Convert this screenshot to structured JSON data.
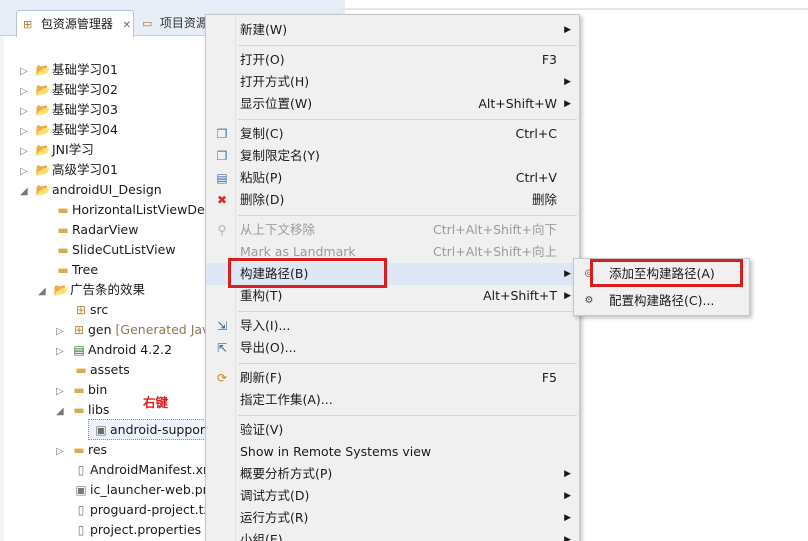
{
  "explorer": {
    "tabs": [
      {
        "label": "包资源管理器",
        "close": "✕"
      },
      {
        "label": "项目资源",
        "close": ""
      }
    ],
    "tree": [
      {
        "label": "基础学习01",
        "decor": ""
      },
      {
        "label": "基础学习02",
        "decor": ""
      },
      {
        "label": "基础学习03",
        "decor": ""
      },
      {
        "label": "基础学习04",
        "decor": ""
      },
      {
        "label": "JNI学习",
        "decor": ""
      },
      {
        "label": "高级学习01",
        "decor": ""
      },
      {
        "label": "androidUI_Design",
        "decor": ""
      },
      {
        "label": "HorizontalListViewDem",
        "decor": ""
      },
      {
        "label": "RadarView",
        "decor": ""
      },
      {
        "label": "SlideCutListView",
        "decor": ""
      },
      {
        "label": "Tree",
        "decor": ""
      },
      {
        "label": "广告条的效果",
        "decor": ""
      },
      {
        "label": "src",
        "decor": ""
      },
      {
        "label": "gen",
        "decor": "[Generated Jav"
      },
      {
        "label": "Android 4.2.2",
        "decor": ""
      },
      {
        "label": "assets",
        "decor": ""
      },
      {
        "label": "bin",
        "decor": ""
      },
      {
        "label": "libs",
        "decor": ""
      },
      {
        "label": "android-suppor",
        "decor": ""
      },
      {
        "label": "res",
        "decor": ""
      },
      {
        "label": "AndroidManifest.xn",
        "decor": ""
      },
      {
        "label": "ic_launcher-web.png",
        "decor": ""
      },
      {
        "label": "proguard-project.tx",
        "decor": ""
      },
      {
        "label": "project.properties",
        "decor": ""
      }
    ],
    "annotation": "右键"
  },
  "context_menu": {
    "items": [
      {
        "label": "新建(W)",
        "shortcut": "",
        "submenu": true
      },
      {
        "label": "打开(O)",
        "shortcut": "F3",
        "submenu": false
      },
      {
        "label": "打开方式(H)",
        "shortcut": "",
        "submenu": true
      },
      {
        "label": "显示位置(W)",
        "shortcut": "Alt+Shift+W",
        "submenu": true
      },
      {
        "label": "复制(C)",
        "shortcut": "Ctrl+C",
        "submenu": false
      },
      {
        "label": "复制限定名(Y)",
        "shortcut": "",
        "submenu": false
      },
      {
        "label": "粘贴(P)",
        "shortcut": "Ctrl+V",
        "submenu": false
      },
      {
        "label": "删除(D)",
        "shortcut": "删除",
        "submenu": false
      },
      {
        "label": "从上下文移除",
        "shortcut": "Ctrl+Alt+Shift+向下",
        "submenu": false
      },
      {
        "label": "Mark as Landmark",
        "shortcut": "Ctrl+Alt+Shift+向上",
        "submenu": false
      },
      {
        "label": "构建路径(B)",
        "shortcut": "",
        "submenu": true
      },
      {
        "label": "重构(T)",
        "shortcut": "Alt+Shift+T",
        "submenu": true
      },
      {
        "label": "导入(I)...",
        "shortcut": "",
        "submenu": false
      },
      {
        "label": "导出(O)...",
        "shortcut": "",
        "submenu": false
      },
      {
        "label": "刷新(F)",
        "shortcut": "F5",
        "submenu": false
      },
      {
        "label": "指定工作集(A)...",
        "shortcut": "",
        "submenu": false
      },
      {
        "label": "验证(V)",
        "shortcut": "",
        "submenu": false
      },
      {
        "label": "Show in Remote Systems view",
        "shortcut": "",
        "submenu": false
      },
      {
        "label": "概要分析方式(P)",
        "shortcut": "",
        "submenu": true
      },
      {
        "label": "调试方式(D)",
        "shortcut": "",
        "submenu": true
      },
      {
        "label": "运行方式(R)",
        "shortcut": "",
        "submenu": true
      },
      {
        "label": "小组(E)",
        "shortcut": "",
        "submenu": true
      }
    ],
    "submenu_arrow": "▶"
  },
  "build_path_submenu": {
    "items": [
      {
        "label": "添加至构建路径(A)"
      },
      {
        "label": "配置构建路径(C)..."
      }
    ]
  },
  "icons": {
    "project": "project-folder-icon",
    "package": "package-icon",
    "folder": "folder-icon",
    "jar": "jar-file-icon",
    "file": "file-icon",
    "library": "android-library-icon"
  },
  "colors": {
    "highlight_box": "#d81f1f",
    "menu_background": "#f0f0f0",
    "tab_bar": "#e8eef7"
  }
}
